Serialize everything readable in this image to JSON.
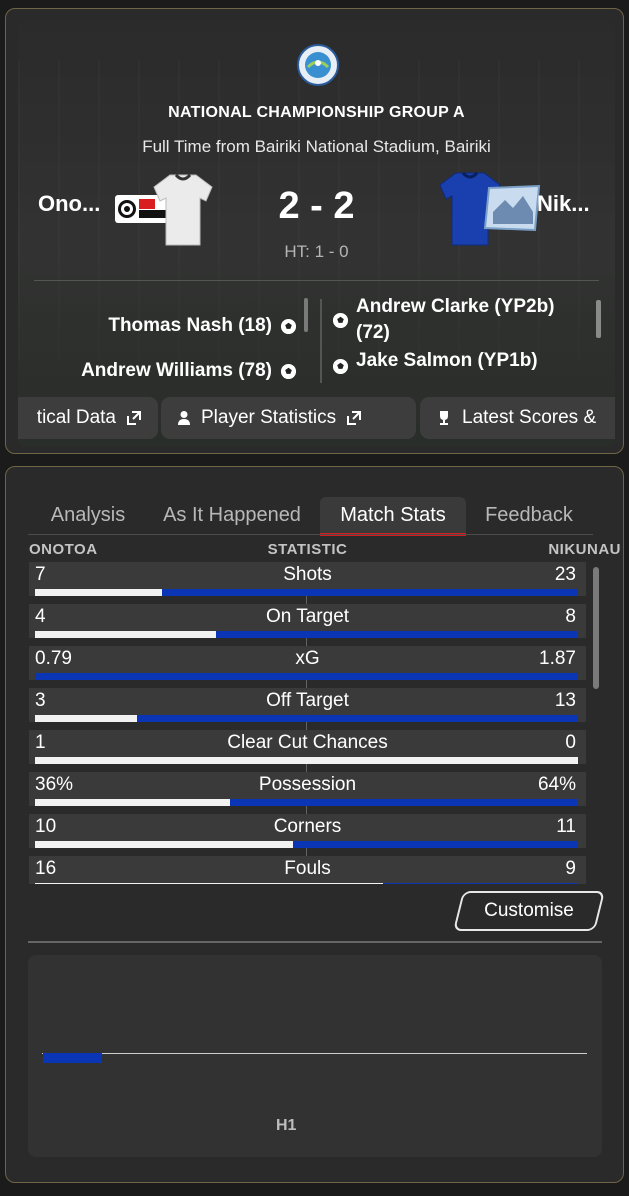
{
  "match": {
    "competition": "NATIONAL CHAMPIONSHIP GROUP A",
    "venue_line": "Full Time from Bairiki National Stadium, Bairiki",
    "home_team": "Ono...",
    "away_team": "Nik...",
    "score": "2 - 2",
    "half_time": "HT: 1 - 0",
    "home_scorers": [
      "Thomas Nash (18)",
      "Andrew Williams (78)"
    ],
    "away_scorers": [
      "Andrew Clarke (YP2b) (72)",
      "Jake Salmon (YP1b)"
    ]
  },
  "buttons": {
    "data": "tical Data",
    "player_stats": "Player Statistics",
    "latest": "Latest Scores &"
  },
  "tabs": [
    "Analysis",
    "As It Happened",
    "Match Stats",
    "Feedback"
  ],
  "stats_header": {
    "home": "ONOTOA",
    "stat": "STATISTIC",
    "away": "NIKUNAU"
  },
  "stats": [
    {
      "label": "Shots",
      "home": "7",
      "away": "23",
      "home_share": 0.233
    },
    {
      "label": "On Target",
      "home": "4",
      "away": "8",
      "home_share": 0.333
    },
    {
      "label": "xG",
      "home": "0.79",
      "away": "1.87",
      "home_share": 0.0
    },
    {
      "label": "Off Target",
      "home": "3",
      "away": "13",
      "home_share": 0.1875
    },
    {
      "label": "Clear Cut Chances",
      "home": "1",
      "away": "0",
      "home_share": 1.0
    },
    {
      "label": "Possession",
      "home": "36%",
      "away": "64%",
      "home_share": 0.36
    },
    {
      "label": "Corners",
      "home": "10",
      "away": "11",
      "home_share": 0.476
    },
    {
      "label": "Fouls",
      "home": "16",
      "away": "9",
      "home_share": 0.64
    }
  ],
  "customise_label": "Customise",
  "chart_data": {
    "type": "bar",
    "categories": [
      "H1"
    ],
    "series": [
      {
        "values": [
          1
        ]
      }
    ],
    "xlabel": "",
    "ylabel": ""
  },
  "colors": {
    "home": "#f2f2f2",
    "away": "#0a36b5",
    "accent": "#d01e1e"
  }
}
